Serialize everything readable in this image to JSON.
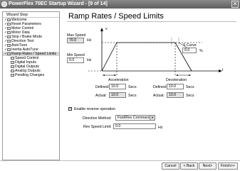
{
  "window": {
    "title": "PowerFlex 70EC Startup Wizard - [9 of 14]",
    "close": "✕"
  },
  "sidebar": {
    "header": "Wizard Step",
    "items": [
      {
        "label": "Welcome",
        "state": "done"
      },
      {
        "label": "Reset Parameters",
        "state": "done"
      },
      {
        "label": "Motor Control",
        "state": "done"
      },
      {
        "label": "Motor Data",
        "state": "done"
      },
      {
        "label": "Stop / Brake Mode",
        "state": "done"
      },
      {
        "label": "Direction Test",
        "state": "done"
      },
      {
        "label": "AutoTune",
        "state": "done"
      },
      {
        "label": "Inertia AutoTune",
        "state": "done"
      },
      {
        "label": "Ramp Rates / Speed Limits",
        "state": "current"
      },
      {
        "label": "Speed Control",
        "state": "pending"
      },
      {
        "label": "Digital Inputs",
        "state": "pending"
      },
      {
        "label": "Digital Outputs",
        "state": "pending"
      },
      {
        "label": "Analog Outputs",
        "state": "pending"
      },
      {
        "label": "Pending Changes",
        "state": "pending"
      }
    ]
  },
  "page": {
    "heading": "Ramp Rates / Speed Limits"
  },
  "diagram": {
    "v_axis": "v",
    "t_axis": "t",
    "max_speed_label": "Max Speed",
    "max_speed_value": "70.0",
    "max_speed_unit": "Hz",
    "min_speed_label": "Min Speed",
    "min_speed_value": "0.0",
    "min_speed_unit": "Hz",
    "s_curve_label": "S Curve",
    "s_curve_value": "0.0",
    "s_curve_unit": "%",
    "acceleration_label": "Acceleration",
    "deceleration_label": "Deceleration",
    "defined_label": "Defined:",
    "actual_label": "Actual:",
    "accel_defined": "10.0",
    "accel_actual": "10.0",
    "decel_defined": "10.0",
    "decel_actual": "10.0",
    "secs": "Secs"
  },
  "reverse": {
    "enable_label": "Enable reverse operation",
    "checked": true,
    "direction_method_label": "Direction Method:",
    "direction_method_value": "Fwd/Rev Command",
    "rev_speed_limit_label": "Rev Speed Limit:",
    "rev_speed_limit_value": "0.0",
    "rev_speed_limit_unit": "Hz"
  },
  "buttons": {
    "cancel": "Cancel",
    "back": "< Back",
    "next": "Next>",
    "finish": "Finish>>"
  }
}
